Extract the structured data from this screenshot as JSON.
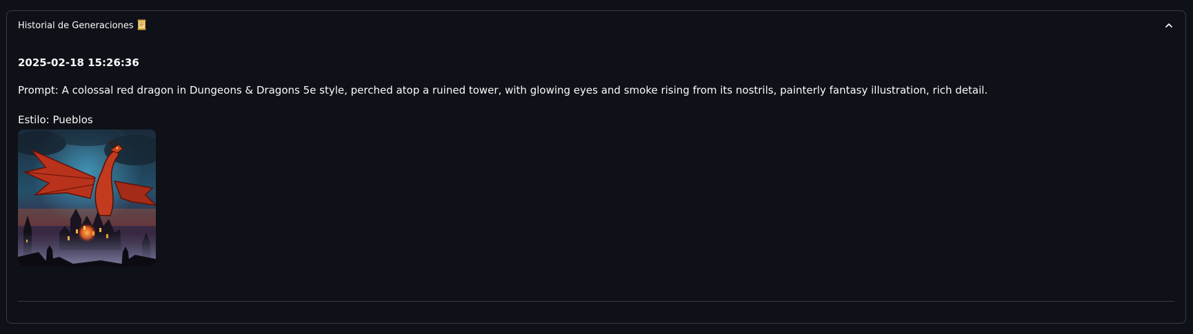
{
  "expander": {
    "title": "Historial de Generaciones",
    "title_icon": "scroll-icon",
    "toggle_icon": "chevron-up-icon",
    "expanded": true
  },
  "entry": {
    "timestamp": "2025-02-18 15:26:36",
    "prompt": "Prompt: A colossal red dragon in Dungeons & Dragons 5e style, perched atop a ruined tower, with glowing eyes and smoke rising from its nostrils, painterly fantasy illustration, rich detail.",
    "style": "Estilo: Pueblos",
    "image_icon": "generated-image-red-dragon-over-castle"
  },
  "colors": {
    "background": "#0e1117",
    "border": "#3a3d45",
    "text": "#fafafa"
  }
}
